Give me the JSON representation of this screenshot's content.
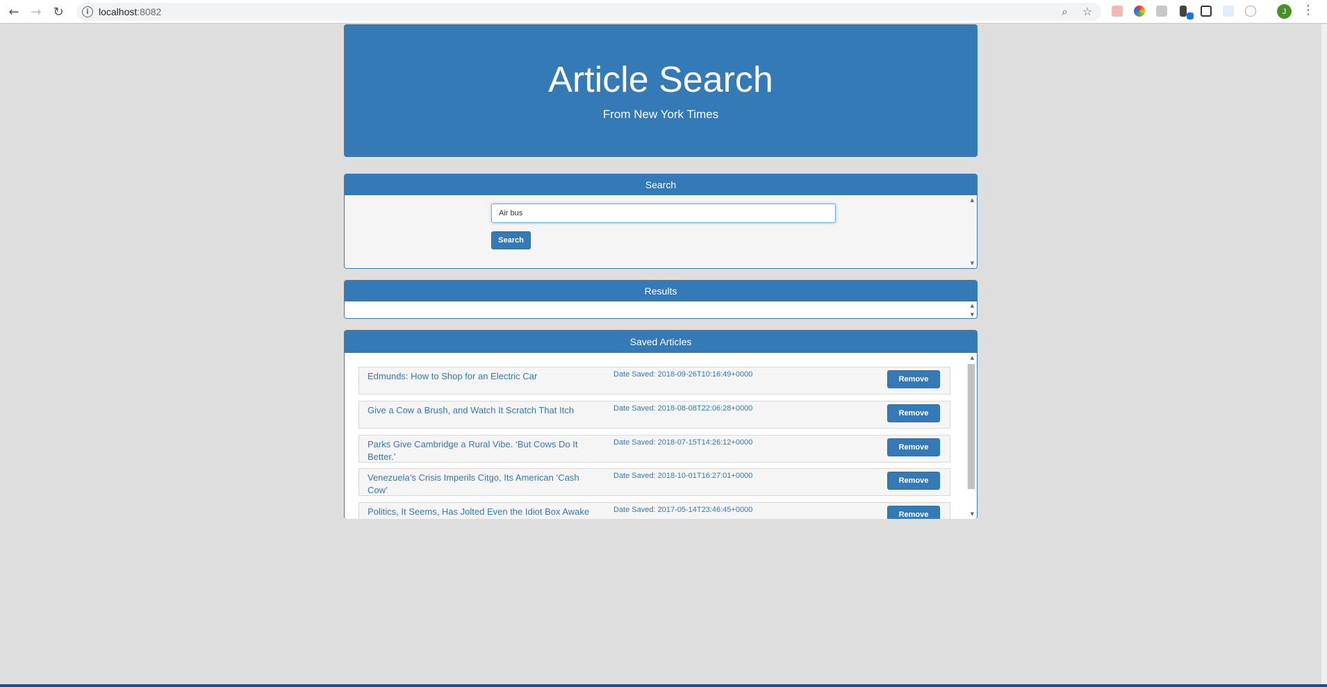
{
  "browser": {
    "url_host": "localhost",
    "url_port": ":8082",
    "avatar_letter": "J"
  },
  "header": {
    "title": "Article Search",
    "subtitle": "From New York Times"
  },
  "search_panel": {
    "heading": "Search",
    "input_value": "Air bus",
    "button_label": "Search"
  },
  "results_panel": {
    "heading": "Results"
  },
  "saved_panel": {
    "heading": "Saved Articles",
    "remove_label": "Remove",
    "articles": [
      {
        "title": "Edmunds: How to Shop for an Electric Car",
        "date": "Date Saved: 2018-09-26T10:16:49+0000"
      },
      {
        "title": "Give a Cow a Brush, and Watch It Scratch That Itch",
        "date": "Date Saved: 2018-08-08T22:06:28+0000"
      },
      {
        "title": "Parks Give Cambridge a Rural Vibe. ‘But Cows Do It Better.’",
        "date": "Date Saved: 2018-07-15T14:26:12+0000"
      },
      {
        "title": "Venezuela’s Crisis Imperils Citgo, Its American ‘Cash Cow’",
        "date": "Date Saved: 2018-10-01T16:27:01+0000"
      },
      {
        "title": "Politics, It Seems, Has Jolted Even the Idiot Box Awake",
        "date": "Date Saved: 2017-05-14T23:46:45+0000"
      }
    ]
  }
}
